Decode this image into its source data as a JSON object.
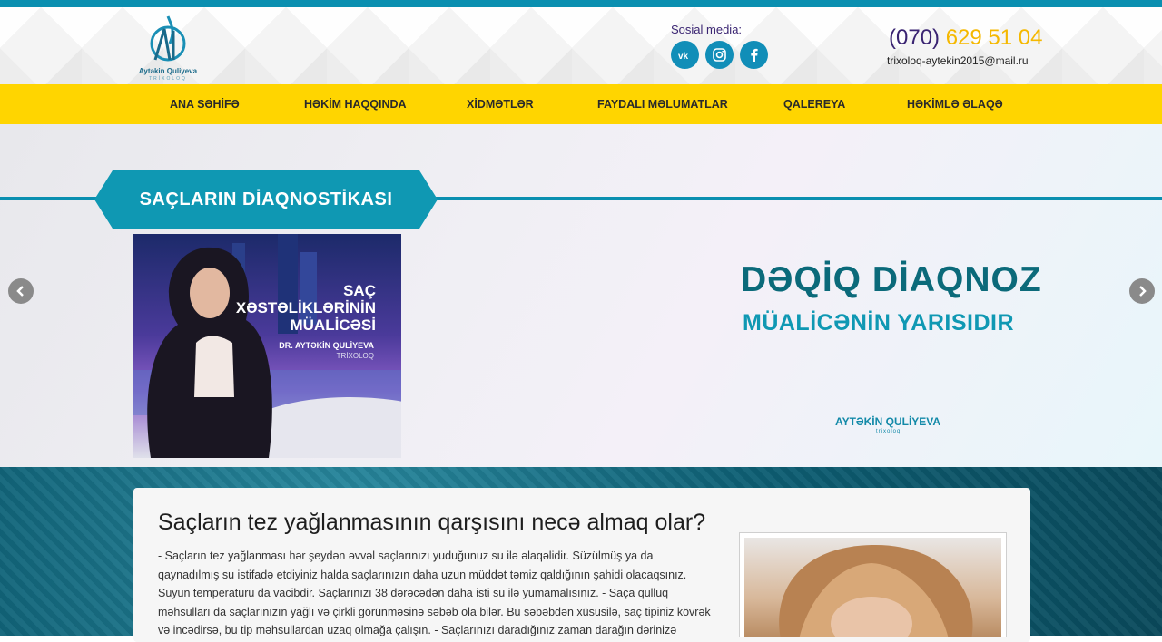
{
  "header": {
    "logo_name": "Aytəkin Quliyeva",
    "logo_sub": "TRİXOLOQ",
    "social_label": "Sosial media:",
    "social": [
      {
        "name": "vk",
        "icon": "vk-icon"
      },
      {
        "name": "instagram",
        "icon": "instagram-icon"
      },
      {
        "name": "facebook",
        "icon": "facebook-icon"
      }
    ],
    "phone_code": "(070)",
    "phone_number": "629 51 04",
    "email": "trixoloq-aytekin2015@mail.ru"
  },
  "nav": {
    "items": [
      "ANA SƏHİFƏ",
      "HƏKİM HAQQINDA",
      "XİDMƏTLƏR",
      "FAYDALI MƏLUMATLAR",
      "QALEREYA",
      "HƏKİMLƏ ƏLAQƏ"
    ]
  },
  "slider": {
    "banner": "SAÇLARIN DİAQNOSTİKASI",
    "poster": {
      "line1": "SAÇ",
      "line2": "XƏSTƏLİKLƏRİNİN",
      "line3": "MÜALİCƏSİ",
      "doctor": "DR. AYTƏKİN QULİYEVA",
      "role": "TRİXOLOQ"
    },
    "headline1": "DƏQİQ DİAQNOZ",
    "headline2": "MÜALİCƏNİN YARISIDIR",
    "brand": "AYTƏKİN QULİYEVA",
    "brand_sub": "trixoloq",
    "prev_icon": "chevron-left-icon",
    "next_icon": "chevron-right-icon"
  },
  "article": {
    "title": "Saçların tez yağlanmasının qarşısını necə almaq olar?",
    "body": "- Saçların tez yağlanması hər şeydən əvvəl saçlarınızı yuduğunuz su ilə əlaqəlidir. Süzülmüş ya da qaynadılmış su istifadə etdiyiniz halda saçlarınızın daha uzun müddət təmiz qaldığının şahidi olacaqsınız. Suyun temperaturu da vacibdir. Saçlarınızı 38 dərəcədən daha isti su ilə yumamalısınız. - Saça qulluq məhsulları da saçlarınızın yağlı və çirkli görünməsinə səbəb ola bilər. Bu səbəbdən xüsusilə, saç tipiniz kövrək və incədirsə, bu tip məhsullardan uzaq olmağa çalışın. - Saçlarınızı daradığınız zaman darağın dərinizə dəyməməsinə diqqət edin və gün ərzində saçlarınıza"
  },
  "colors": {
    "accent": "#0a8fb0",
    "nav_bg": "#ffd500",
    "phone_code": "#3a2472",
    "phone_number": "#f5b800"
  }
}
